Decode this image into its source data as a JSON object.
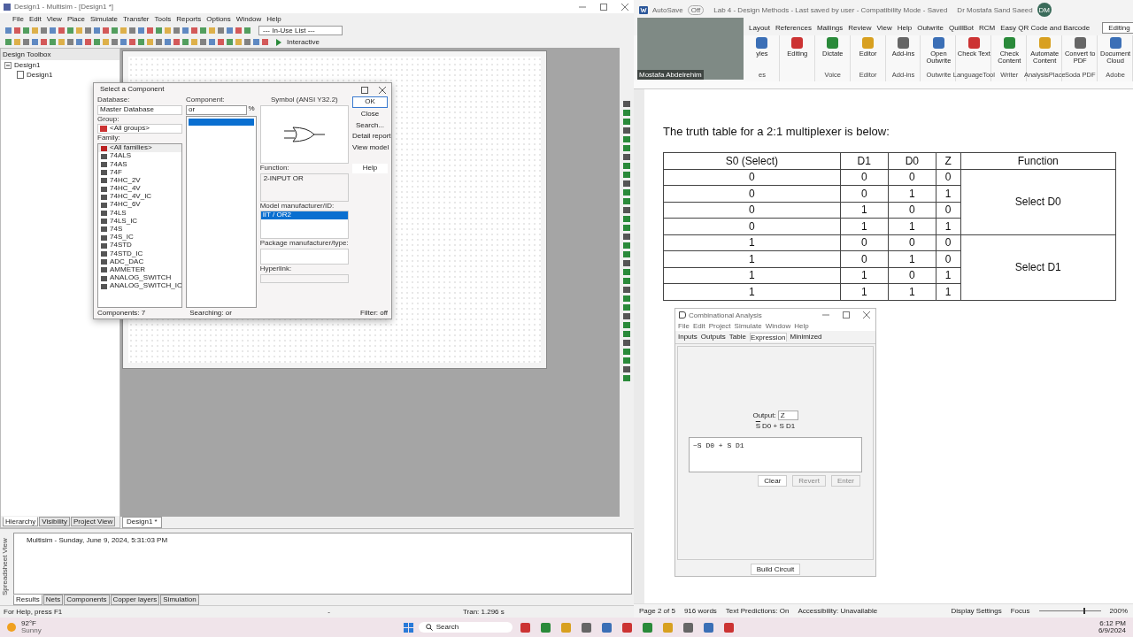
{
  "multisim": {
    "title": "Design1 - Multisim - [Design1 *]",
    "menu": [
      "File",
      "Edit",
      "View",
      "Place",
      "Simulate",
      "Transfer",
      "Tools",
      "Reports",
      "Options",
      "Window",
      "Help"
    ],
    "in_use_list": "--- In-Use List ---",
    "interactive": "Interactive",
    "toolbox": {
      "title": "Design Toolbox",
      "tree": [
        {
          "label": "Design1",
          "expanded": true,
          "children": [
            {
              "label": "Design1"
            }
          ]
        }
      ],
      "tabs": [
        {
          "label": "Hierarchy",
          "selected": true
        },
        {
          "label": "Visibility",
          "selected": false
        },
        {
          "label": "Project View",
          "selected": false
        }
      ]
    },
    "doc_tab": "Design1 *",
    "dialog": {
      "title": "Select a Component",
      "database_label": "Database:",
      "database": "Master Database",
      "group_label": "Group:",
      "group": "<All groups>",
      "family_label": "Family:",
      "families": [
        {
          "label": "<All families>",
          "selected": true
        },
        {
          "label": "74ALS",
          "selected": false
        },
        {
          "label": "74AS",
          "selected": false
        },
        {
          "label": "74F",
          "selected": false
        },
        {
          "label": "74HC_2V",
          "selected": false
        },
        {
          "label": "74HC_4V",
          "selected": false
        },
        {
          "label": "74HC_4V_IC",
          "selected": false
        },
        {
          "label": "74HC_6V",
          "selected": false
        },
        {
          "label": "74LS",
          "selected": false
        },
        {
          "label": "74LS_IC",
          "selected": false
        },
        {
          "label": "74S",
          "selected": false
        },
        {
          "label": "74S_IC",
          "selected": false
        },
        {
          "label": "74STD",
          "selected": false
        },
        {
          "label": "74STD_IC",
          "selected": false
        },
        {
          "label": "ADC_DAC",
          "selected": false
        },
        {
          "label": "AMMETER",
          "selected": false
        },
        {
          "label": "ANALOG_SWITCH",
          "selected": false
        },
        {
          "label": "ANALOG_SWITCH_IC",
          "selected": false
        }
      ],
      "component_label": "Component:",
      "component_search": "or",
      "wildcard": "%",
      "symbol_label": "Symbol (ANSI Y32.2)",
      "buttons": [
        "OK",
        "Close",
        "Search...",
        "Detail report",
        "View model",
        "Help"
      ],
      "function_label": "Function:",
      "function": "2-INPUT OR",
      "model_label": "Model manufacturer/ID:",
      "models": [
        {
          "label": "IIT / OR2",
          "selected": true
        }
      ],
      "package_label": "Package manufacturer/type:",
      "hyperlink_label": "Hyperlink:",
      "status": [
        "Components: 7",
        "Searching: or",
        "Filter: off"
      ]
    },
    "spreadsheet": {
      "side_label": "Spreadsheet View",
      "message": "Multisim  -  Sunday, June 9, 2024, 5:31:03 PM",
      "tabs": [
        {
          "label": "Results",
          "selected": true
        },
        {
          "label": "Nets",
          "selected": false
        },
        {
          "label": "Components",
          "selected": false
        },
        {
          "label": "Copper layers",
          "selected": false
        },
        {
          "label": "Simulation",
          "selected": false
        }
      ]
    },
    "status_bar": [
      "For Help, press F1",
      "-",
      "Tran: 1.296 s"
    ]
  },
  "word": {
    "autosave": "AutoSave",
    "autosave_state": "Off",
    "doc_title": "Lab 4 - Design Methods  -  Last saved by user  -  Compatibility Mode  -  Saved",
    "user": "Dr Mostafa Sand Saeed",
    "user_initials": "DM",
    "tabs": [
      "Layout",
      "References",
      "Mailings",
      "Review",
      "View",
      "Help",
      "Outwrite",
      "QuillBot",
      "RCM",
      "Easy QR Code and Barcode"
    ],
    "editing": "Editing",
    "ribbon": [
      {
        "label": "yles",
        "group": "es"
      },
      {
        "label": "Editing"
      },
      {
        "label": "Dictate",
        "group": "Voice"
      },
      {
        "label": "Editor",
        "group": "Editor"
      },
      {
        "label": "Add-ins",
        "group": "Add-ins"
      },
      {
        "label": "Open Outwrite",
        "group": "Outwrite"
      },
      {
        "label": "Check Text",
        "group": "LanguageTool"
      },
      {
        "label": "Check Content",
        "group": "Writer"
      },
      {
        "label": "Automate Content",
        "group": "AnalysisPlace"
      },
      {
        "label": "Convert to PDF",
        "group": "Soda PDF"
      },
      {
        "label": "Document Cloud",
        "group": "Adobe"
      }
    ],
    "webcam_name": "Mostafa Abdelrehim",
    "paragraph": "The truth table for a 2:1 multiplexer is below:",
    "table": {
      "columns": [
        "S0 (Select)",
        "D1",
        "D0",
        "Z",
        "Function"
      ],
      "groups": [
        {
          "function": "Select D0",
          "rows": [
            [
              "0",
              "0",
              "0",
              "0"
            ],
            [
              "0",
              "0",
              "1",
              "1"
            ],
            [
              "0",
              "1",
              "0",
              "0"
            ],
            [
              "0",
              "1",
              "1",
              "1"
            ]
          ]
        },
        {
          "function": "Select D1",
          "rows": [
            [
              "1",
              "0",
              "0",
              "0"
            ],
            [
              "1",
              "0",
              "1",
              "0"
            ],
            [
              "1",
              "1",
              "0",
              "1"
            ],
            [
              "1",
              "1",
              "1",
              "1"
            ]
          ]
        }
      ]
    },
    "status": {
      "page": "Page 2 of 5",
      "words": "916 words",
      "predictions": "Text Predictions: On",
      "accessibility": "Accessibility: Unavailable",
      "display": "Display Settings",
      "focus": "Focus",
      "zoom": "200%",
      "zoom_slider": {
        "level": 0.72
      }
    }
  },
  "combinational": {
    "title": "Combinational Analysis",
    "menu": [
      "File",
      "Edit",
      "Project",
      "Simulate",
      "Window",
      "Help"
    ],
    "tabs": [
      {
        "label": "Inputs",
        "selected": false
      },
      {
        "label": "Outputs",
        "selected": false
      },
      {
        "label": "Table",
        "selected": false
      },
      {
        "label": "Expression",
        "selected": true
      },
      {
        "label": "Minimized",
        "selected": false
      }
    ],
    "output_label": "Output:",
    "output": "Z",
    "expression": [
      {
        "text": "S",
        "negated": true
      },
      {
        "text": "D0 + S D1",
        "negated": false
      }
    ],
    "expression_input": "~S D0 + S D1",
    "buttons": [
      {
        "label": "Clear",
        "disabled": false
      },
      {
        "label": "Revert",
        "disabled": true
      },
      {
        "label": "Enter",
        "disabled": true
      }
    ],
    "build": "Build Circuit"
  },
  "taskbar": {
    "temperature": "92°F",
    "weather": "Sunny",
    "search": "Search",
    "time": "6:12 PM",
    "date": "6/9/2024"
  }
}
